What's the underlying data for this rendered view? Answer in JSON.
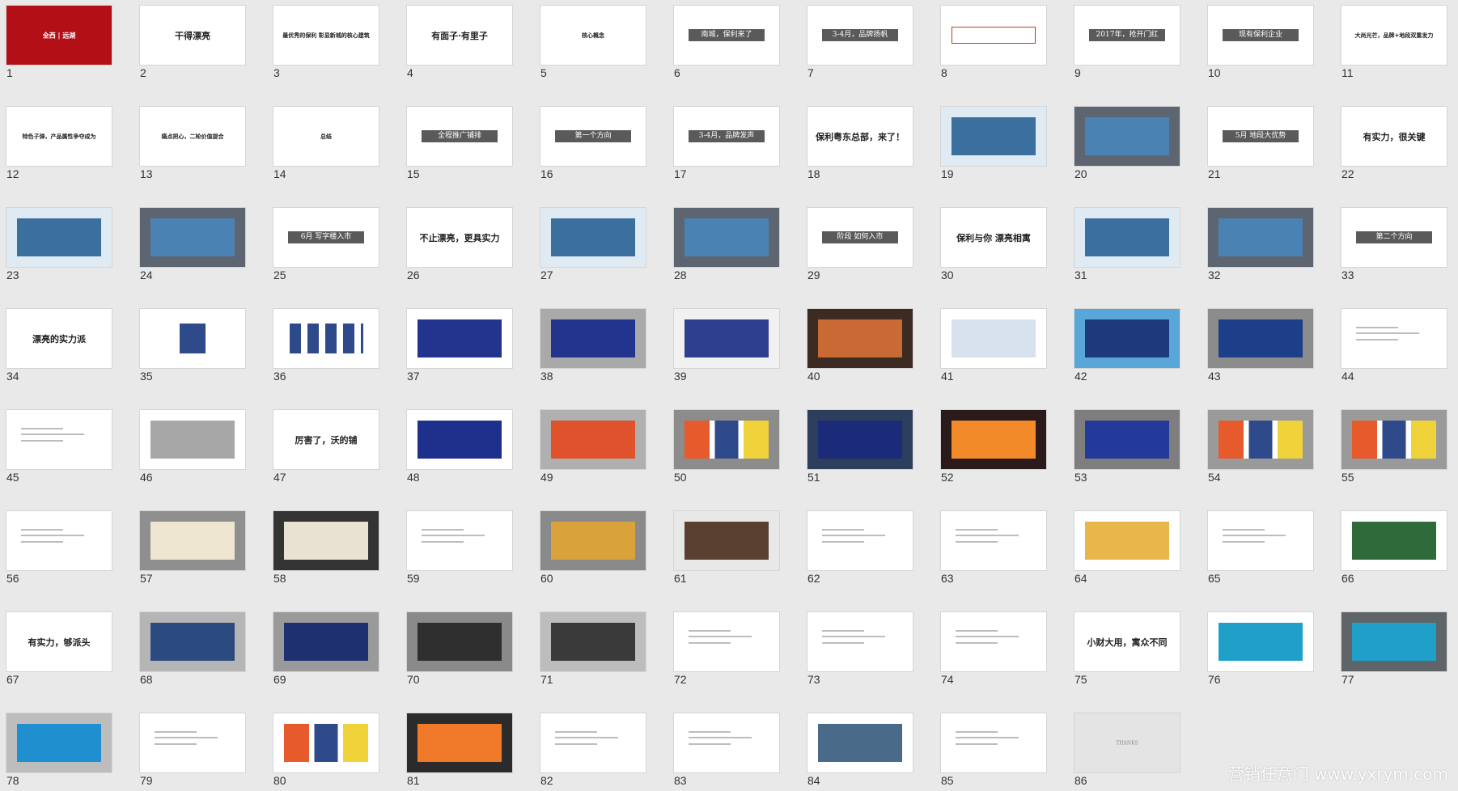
{
  "watermark": "营销任意门 www.yxrym.com",
  "slides": [
    {
      "n": "1",
      "kind": "red",
      "title": "全西 | 远湖"
    },
    {
      "n": "2",
      "kind": "title",
      "title": "干得漂亮"
    },
    {
      "n": "3",
      "kind": "text",
      "title": "最优秀的保利 彰显新城的核心建筑"
    },
    {
      "n": "4",
      "kind": "title",
      "title": "有面子·有里子"
    },
    {
      "n": "5",
      "kind": "text",
      "title": "核心概念"
    },
    {
      "n": "6",
      "kind": "bar",
      "title": "南城，保利来了"
    },
    {
      "n": "7",
      "kind": "bar",
      "title": "3-4月，品牌扬帆"
    },
    {
      "n": "8",
      "kind": "diagram",
      "title": ""
    },
    {
      "n": "9",
      "kind": "bar",
      "title": "2017年，抢开门红"
    },
    {
      "n": "10",
      "kind": "bar",
      "title": "现有保利企业"
    },
    {
      "n": "11",
      "kind": "text",
      "title": "大尚光芒，品牌+地段双重发力"
    },
    {
      "n": "12",
      "kind": "text",
      "title": "特色子弹，产品属性争夺成为"
    },
    {
      "n": "13",
      "kind": "text",
      "title": "痛点把心，二轮价值提合"
    },
    {
      "n": "14",
      "kind": "text",
      "title": "总结"
    },
    {
      "n": "15",
      "kind": "bar",
      "title": "全程推广铺排"
    },
    {
      "n": "16",
      "kind": "bar",
      "title": "第一个方向"
    },
    {
      "n": "17",
      "kind": "bar",
      "title": "3-4月，品牌发声"
    },
    {
      "n": "18",
      "kind": "title",
      "title": "保利粤东总部，来了！"
    },
    {
      "n": "19",
      "kind": "blueimg",
      "title": ""
    },
    {
      "n": "20",
      "kind": "billboard",
      "title": ""
    },
    {
      "n": "21",
      "kind": "bar",
      "title": "5月 地段大优势"
    },
    {
      "n": "22",
      "kind": "title",
      "title": "有实力，很关键"
    },
    {
      "n": "23",
      "kind": "blueimg",
      "title": ""
    },
    {
      "n": "24",
      "kind": "billboard",
      "title": ""
    },
    {
      "n": "25",
      "kind": "bar",
      "title": "6月 写字楼入市"
    },
    {
      "n": "26",
      "kind": "title",
      "title": "不止漂亮，更具实力"
    },
    {
      "n": "27",
      "kind": "blueimg",
      "title": ""
    },
    {
      "n": "28",
      "kind": "billboard",
      "title": ""
    },
    {
      "n": "29",
      "kind": "bar",
      "title": "阶段 如何入市"
    },
    {
      "n": "30",
      "kind": "title",
      "title": "保利与你 漂亮相寓"
    },
    {
      "n": "31",
      "kind": "blueimg",
      "title": ""
    },
    {
      "n": "32",
      "kind": "billboard",
      "title": ""
    },
    {
      "n": "33",
      "kind": "bar",
      "title": "第二个方向"
    },
    {
      "n": "34",
      "kind": "title",
      "title": "漂亮的实力派"
    },
    {
      "n": "35",
      "kind": "logo",
      "title": ""
    },
    {
      "n": "36",
      "kind": "logos",
      "title": ""
    },
    {
      "n": "37",
      "kind": "navyimg",
      "title": ""
    },
    {
      "n": "38",
      "kind": "billboardnavy",
      "title": ""
    },
    {
      "n": "39",
      "kind": "posters",
      "title": ""
    },
    {
      "n": "40",
      "kind": "busstop",
      "title": ""
    },
    {
      "n": "41",
      "kind": "bag",
      "title": ""
    },
    {
      "n": "42",
      "kind": "banner",
      "title": ""
    },
    {
      "n": "43",
      "kind": "cards",
      "title": ""
    },
    {
      "n": "44",
      "kind": "text",
      "title": ""
    },
    {
      "n": "45",
      "kind": "text",
      "title": ""
    },
    {
      "n": "46",
      "kind": "greybox",
      "title": ""
    },
    {
      "n": "47",
      "kind": "title",
      "title": "厉害了，沃的铺"
    },
    {
      "n": "48",
      "kind": "colorimg",
      "title": ""
    },
    {
      "n": "49",
      "kind": "billboardcolor",
      "title": ""
    },
    {
      "n": "50",
      "kind": "colorposters",
      "title": ""
    },
    {
      "n": "51",
      "kind": "phone",
      "title": ""
    },
    {
      "n": "52",
      "kind": "nightscene",
      "title": ""
    },
    {
      "n": "53",
      "kind": "screen",
      "title": ""
    },
    {
      "n": "54",
      "kind": "colorposters2",
      "title": ""
    },
    {
      "n": "55",
      "kind": "colorposters2",
      "title": ""
    },
    {
      "n": "56",
      "kind": "text",
      "title": ""
    },
    {
      "n": "57",
      "kind": "cards2",
      "title": ""
    },
    {
      "n": "58",
      "kind": "phone2",
      "title": ""
    },
    {
      "n": "59",
      "kind": "text",
      "title": ""
    },
    {
      "n": "60",
      "kind": "candles",
      "title": ""
    },
    {
      "n": "61",
      "kind": "hand",
      "title": ""
    },
    {
      "n": "62",
      "kind": "text",
      "title": ""
    },
    {
      "n": "63",
      "kind": "text",
      "title": ""
    },
    {
      "n": "64",
      "kind": "fruit",
      "title": ""
    },
    {
      "n": "65",
      "kind": "text",
      "title": ""
    },
    {
      "n": "66",
      "kind": "cans",
      "title": ""
    },
    {
      "n": "67",
      "kind": "title",
      "title": "有实力，够派头"
    },
    {
      "n": "68",
      "kind": "man",
      "title": ""
    },
    {
      "n": "69",
      "kind": "man2",
      "title": ""
    },
    {
      "n": "70",
      "kind": "station",
      "title": ""
    },
    {
      "n": "71",
      "kind": "magazine",
      "title": ""
    },
    {
      "n": "72",
      "kind": "text",
      "title": ""
    },
    {
      "n": "73",
      "kind": "text",
      "title": ""
    },
    {
      "n": "74",
      "kind": "text",
      "title": ""
    },
    {
      "n": "75",
      "kind": "title",
      "title": "小财大用，寓众不同"
    },
    {
      "n": "76",
      "kind": "tealimg",
      "title": ""
    },
    {
      "n": "77",
      "kind": "tealstation",
      "title": ""
    },
    {
      "n": "78",
      "kind": "tealmag",
      "title": ""
    },
    {
      "n": "79",
      "kind": "text",
      "title": ""
    },
    {
      "n": "80",
      "kind": "colorboxes",
      "title": ""
    },
    {
      "n": "81",
      "kind": "phone3",
      "title": ""
    },
    {
      "n": "82",
      "kind": "text",
      "title": ""
    },
    {
      "n": "83",
      "kind": "text",
      "title": ""
    },
    {
      "n": "84",
      "kind": "photos",
      "title": ""
    },
    {
      "n": "85",
      "kind": "text",
      "title": ""
    },
    {
      "n": "86",
      "kind": "thanks",
      "title": "THANKS"
    }
  ]
}
